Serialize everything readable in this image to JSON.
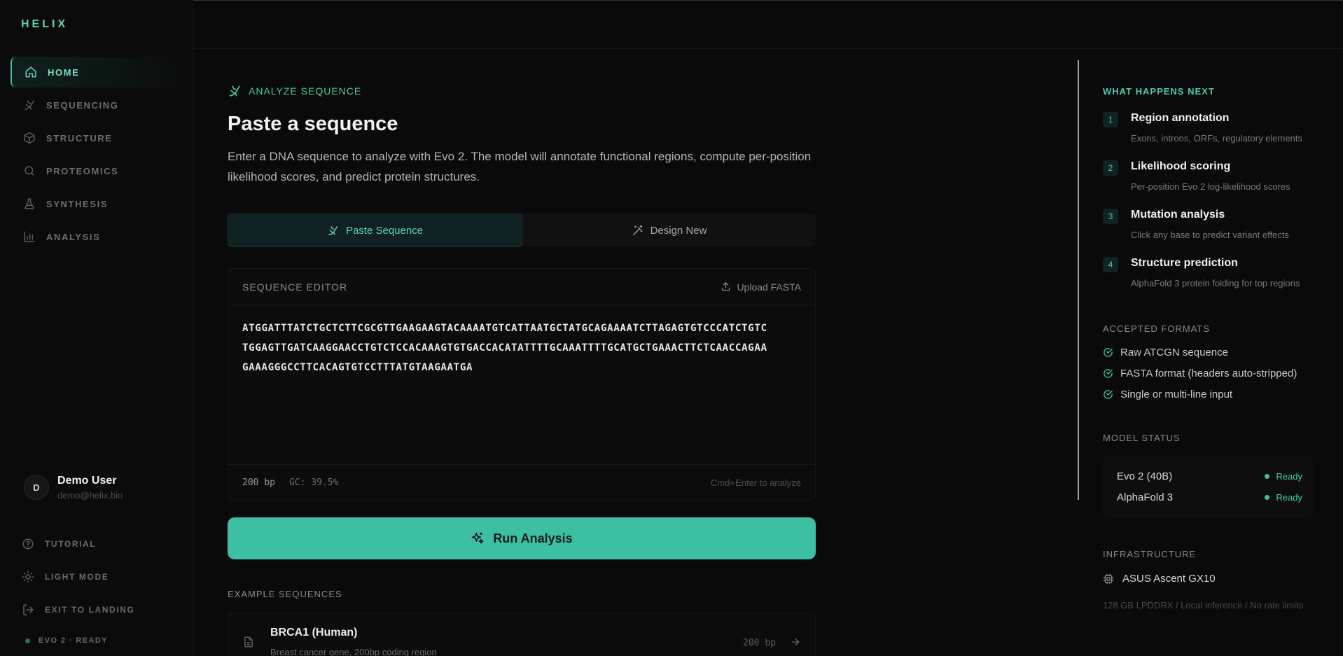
{
  "app": {
    "brand": "HELIX"
  },
  "sidebar": {
    "items": [
      {
        "label": "HOME",
        "icon": "home-icon",
        "active": true
      },
      {
        "label": "SEQUENCING",
        "icon": "dna-icon",
        "active": false
      },
      {
        "label": "STRUCTURE",
        "icon": "cube-icon",
        "active": false
      },
      {
        "label": "PROTEOMICS",
        "icon": "search-icon",
        "active": false
      },
      {
        "label": "SYNTHESIS",
        "icon": "flask-icon",
        "active": false
      },
      {
        "label": "ANALYSIS",
        "icon": "bar-chart-icon",
        "active": false
      }
    ],
    "user": {
      "initial": "D",
      "name": "Demo User",
      "email": "demo@helix.bio"
    },
    "bottom": [
      {
        "label": "TUTORIAL",
        "icon": "help-circle-icon"
      },
      {
        "label": "LIGHT MODE",
        "icon": "sun-icon"
      },
      {
        "label": "EXIT TO LANDING",
        "icon": "log-out-icon"
      }
    ],
    "status": "EVO 2 · READY"
  },
  "main": {
    "kicker": "ANALYZE SEQUENCE",
    "title": "Paste a sequence",
    "description": "Enter a DNA sequence to analyze with Evo 2. The model will annotate functional regions, compute per-position likelihood scores, and predict protein structures.",
    "tabs": [
      {
        "label": "Paste Sequence",
        "icon": "dna-icon",
        "active": true
      },
      {
        "label": "Design New",
        "icon": "wand-icon",
        "active": false
      }
    ],
    "editor": {
      "title": "SEQUENCE EDITOR",
      "upload_label": "Upload FASTA",
      "lines": [
        "ATGGATTTATCTGCTCTTCGCGTTGAAGAAGTACAAAATGTCATTAATGCTATGCAGAAAATCTTAGAGTGTCCCATCTGTC",
        "TGGAGTTGATCAAGGAACCTGTCTCCACAAAGTGTGACCACATATTTTGCAAATTTTGCATGCTGAAACTTCTCAACCAGAA",
        "GAAAGGGCCTTCACAGTGTCCTTTATGTAAGAATGA"
      ],
      "length": "200 bp",
      "gc": "GC: 39.5%",
      "hint": "Cmd+Enter to analyze"
    },
    "run_label": "Run Analysis",
    "examples_title": "EXAMPLE SEQUENCES",
    "examples": [
      {
        "name": "BRCA1 (Human)",
        "description": "Breast cancer gene, 200bp coding region",
        "length": "200 bp"
      }
    ]
  },
  "rail": {
    "next_title": "WHAT HAPPENS NEXT",
    "steps": [
      {
        "num": "1",
        "title": "Region annotation",
        "desc": "Exons, introns, ORFs, regulatory elements"
      },
      {
        "num": "2",
        "title": "Likelihood scoring",
        "desc": "Per-position Evo 2 log-likelihood scores"
      },
      {
        "num": "3",
        "title": "Mutation analysis",
        "desc": "Click any base to predict variant effects"
      },
      {
        "num": "4",
        "title": "Structure prediction",
        "desc": "AlphaFold 3 protein folding for top regions"
      }
    ],
    "formats_title": "ACCEPTED FORMATS",
    "formats": [
      "Raw ATCGN sequence",
      "FASTA format (headers auto-stripped)",
      "Single or multi-line input"
    ],
    "model_title": "MODEL STATUS",
    "models": [
      {
        "name": "Evo 2 (40B)",
        "status": "Ready"
      },
      {
        "name": "AlphaFold 3",
        "status": "Ready"
      }
    ],
    "infra_title": "INFRASTRUCTURE",
    "infra_name": "ASUS Ascent GX10",
    "infra_sub": "128 GB LPDDRX / Local inference / No rate limits"
  },
  "colors": {
    "accent": "#3dbfa4",
    "accent_text": "#4fc9ad",
    "background": "#0a0a0a"
  }
}
